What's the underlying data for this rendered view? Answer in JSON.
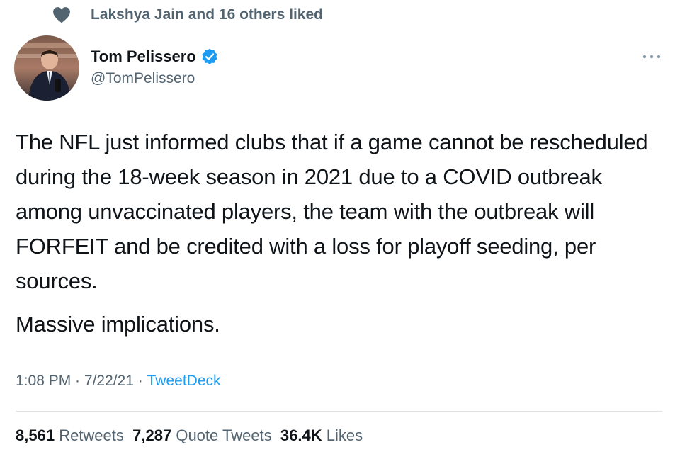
{
  "social_context": {
    "icon": "heart-icon",
    "text": "Lakshya Jain and 16 others liked"
  },
  "author": {
    "name": "Tom Pelissero",
    "handle": "@TomPelissero",
    "verified": true,
    "avatar_icon": "profile-photo"
  },
  "more_menu": {
    "icon": "more-dots-icon"
  },
  "tweet": {
    "paragraphs": [
      "The NFL just informed clubs that if a game cannot be rescheduled during the 18-week season in 2021 due to a COVID outbreak among unvaccinated players, the team with the outbreak will FORFEIT and be credited with a loss for playoff seeding, per sources.",
      "Massive implications."
    ],
    "time": "1:08 PM",
    "separator": " · ",
    "date": "7/22/21",
    "source": "TweetDeck"
  },
  "stats": {
    "retweets_count": "8,561",
    "retweets_label": "Retweets",
    "quotes_count": "7,287",
    "quotes_label": "Quote Tweets",
    "likes_count": "36.4K",
    "likes_label": "Likes"
  },
  "colors": {
    "secondary_text": "#536471",
    "link": "#1d9bf0",
    "primary_text": "#0f1419"
  }
}
